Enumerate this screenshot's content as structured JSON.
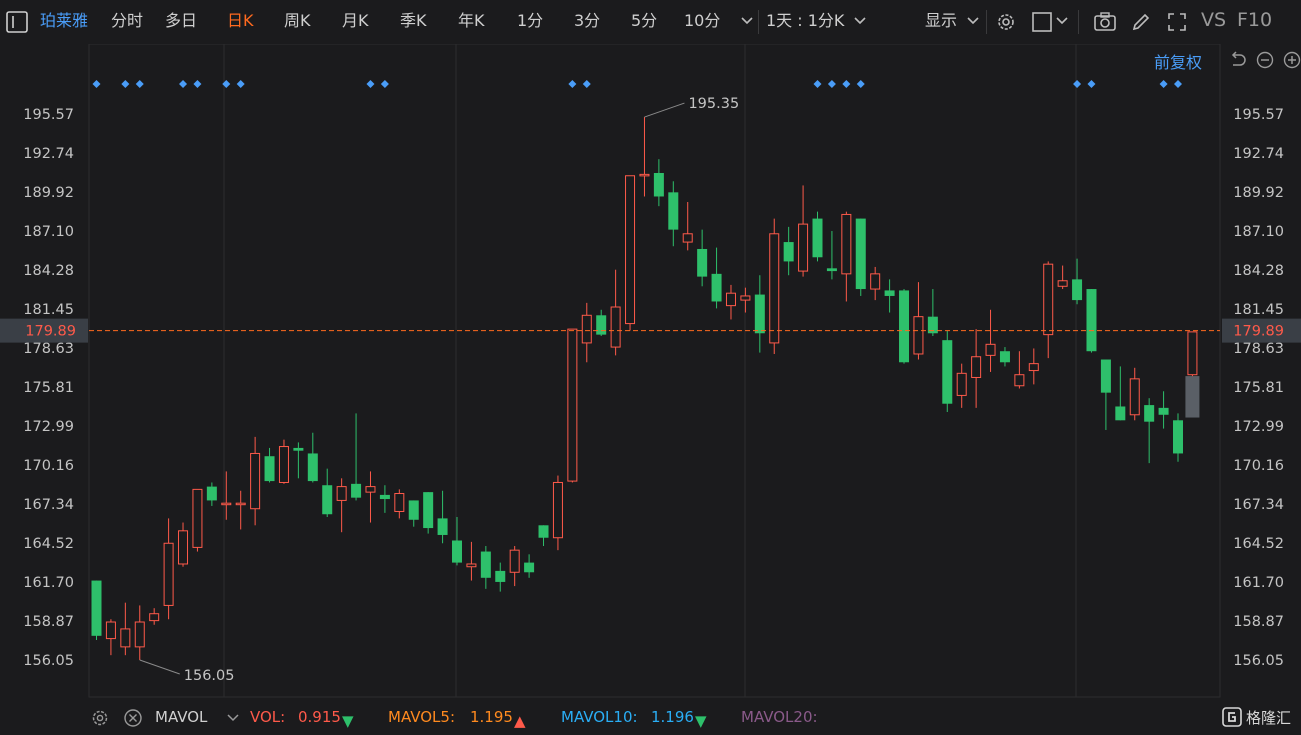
{
  "toolbar": {
    "stock_name": "珀莱雅",
    "periods": [
      "分时",
      "多日",
      "日K",
      "周K",
      "月K",
      "季K",
      "年K",
      "1分",
      "3分",
      "5分",
      "10分"
    ],
    "active_period": "日K",
    "interval_select": "1天 : 1分K",
    "display_label": "显示",
    "vs_label": "VS",
    "f10_label": "F10"
  },
  "colors": {
    "background": "#1b1b1d",
    "up": "#ff5a4a",
    "down": "#2ec06b",
    "active_tab": "#ff6a1f",
    "accent_blue": "#4a9df8",
    "current_price_line": "#ff6a1f",
    "grid": "#2c2c2e",
    "ghost_candle": "#5a5f66"
  },
  "icons": {
    "sidebar_toggle": "sidebar-toggle-icon",
    "dropdown": "chevron-down-icon",
    "settings": "gear-icon",
    "layout": "square-icon",
    "camera": "camera-icon",
    "draw": "pencil-icon",
    "fullscreen": "expand-icon",
    "reset_zoom": "undo-icon",
    "zoom_out": "zoom-out-icon",
    "zoom_in": "zoom-in-icon",
    "close": "close-circle-icon"
  },
  "adjust_label": "前复权",
  "current_price": "179.89",
  "chart_data": {
    "type": "candlestick",
    "y_ticks": [
      "195.57",
      "192.74",
      "189.92",
      "187.10",
      "184.28",
      "181.45",
      "178.63",
      "175.81",
      "172.99",
      "170.16",
      "167.34",
      "164.52",
      "161.70",
      "158.87",
      "156.05"
    ],
    "ylim": [
      156.05,
      195.57
    ],
    "current_price": 179.89,
    "max_annotation": {
      "value": 195.35,
      "label": "195.35",
      "index": 38
    },
    "min_annotation": {
      "value": 156.05,
      "label": "156.05",
      "index": 3
    },
    "candles": [
      {
        "o": 161.8,
        "h": 161.8,
        "l": 157.5,
        "c": 157.8
      },
      {
        "o": 157.6,
        "h": 159.0,
        "l": 156.4,
        "c": 158.8
      },
      {
        "o": 157.0,
        "h": 160.2,
        "l": 156.4,
        "c": 158.3
      },
      {
        "o": 157.0,
        "h": 160.0,
        "l": 156.05,
        "c": 158.8
      },
      {
        "o": 158.9,
        "h": 159.8,
        "l": 158.6,
        "c": 159.4
      },
      {
        "o": 160.0,
        "h": 166.3,
        "l": 159.0,
        "c": 164.5
      },
      {
        "o": 163.0,
        "h": 166.0,
        "l": 162.8,
        "c": 165.4
      },
      {
        "o": 164.2,
        "h": 168.4,
        "l": 163.9,
        "c": 168.4
      },
      {
        "o": 168.6,
        "h": 168.9,
        "l": 167.2,
        "c": 167.6
      },
      {
        "o": 167.4,
        "h": 169.7,
        "l": 166.2,
        "c": 167.4
      },
      {
        "o": 167.3,
        "h": 168.3,
        "l": 165.5,
        "c": 167.4
      },
      {
        "o": 167.0,
        "h": 172.2,
        "l": 165.8,
        "c": 171.0
      },
      {
        "o": 170.8,
        "h": 171.4,
        "l": 168.9,
        "c": 169.0
      },
      {
        "o": 168.9,
        "h": 172.0,
        "l": 168.8,
        "c": 171.5
      },
      {
        "o": 171.4,
        "h": 171.8,
        "l": 169.2,
        "c": 171.2
      },
      {
        "o": 171.0,
        "h": 172.5,
        "l": 168.9,
        "c": 169.0
      },
      {
        "o": 168.7,
        "h": 169.9,
        "l": 166.4,
        "c": 166.6
      },
      {
        "o": 167.6,
        "h": 169.2,
        "l": 165.3,
        "c": 168.6
      },
      {
        "o": 168.8,
        "h": 173.9,
        "l": 167.6,
        "c": 167.8
      },
      {
        "o": 168.2,
        "h": 169.7,
        "l": 166.0,
        "c": 168.6
      },
      {
        "o": 168.0,
        "h": 168.7,
        "l": 166.7,
        "c": 167.7
      },
      {
        "o": 166.8,
        "h": 168.4,
        "l": 166.3,
        "c": 168.1
      },
      {
        "o": 167.6,
        "h": 167.6,
        "l": 165.7,
        "c": 166.2
      },
      {
        "o": 168.2,
        "h": 168.2,
        "l": 165.2,
        "c": 165.6
      },
      {
        "o": 166.3,
        "h": 168.3,
        "l": 164.5,
        "c": 165.1
      },
      {
        "o": 164.7,
        "h": 166.4,
        "l": 162.9,
        "c": 163.1
      },
      {
        "o": 162.8,
        "h": 164.6,
        "l": 161.8,
        "c": 163.0
      },
      {
        "o": 163.9,
        "h": 164.3,
        "l": 161.2,
        "c": 162.0
      },
      {
        "o": 162.5,
        "h": 163.1,
        "l": 161.0,
        "c": 161.7
      },
      {
        "o": 162.4,
        "h": 164.3,
        "l": 161.4,
        "c": 164.0
      },
      {
        "o": 163.1,
        "h": 163.7,
        "l": 162.0,
        "c": 162.4
      },
      {
        "o": 165.8,
        "h": 165.8,
        "l": 164.3,
        "c": 164.9
      },
      {
        "o": 164.9,
        "h": 169.4,
        "l": 164.0,
        "c": 168.9
      },
      {
        "o": 169.0,
        "h": 180.0,
        "l": 168.9,
        "c": 180.0
      },
      {
        "o": 179.0,
        "h": 181.9,
        "l": 177.6,
        "c": 181.0
      },
      {
        "o": 181.0,
        "h": 181.4,
        "l": 179.5,
        "c": 179.6
      },
      {
        "o": 178.7,
        "h": 184.3,
        "l": 178.1,
        "c": 181.6
      },
      {
        "o": 180.4,
        "h": 189.8,
        "l": 179.9,
        "c": 191.1
      },
      {
        "o": 191.1,
        "h": 195.35,
        "l": 189.6,
        "c": 191.2
      },
      {
        "o": 191.3,
        "h": 192.3,
        "l": 188.9,
        "c": 189.6
      },
      {
        "o": 189.9,
        "h": 190.7,
        "l": 186.0,
        "c": 187.2
      },
      {
        "o": 186.3,
        "h": 189.2,
        "l": 185.7,
        "c": 186.9
      },
      {
        "o": 185.8,
        "h": 187.2,
        "l": 183.1,
        "c": 183.8
      },
      {
        "o": 184.0,
        "h": 185.9,
        "l": 181.5,
        "c": 182.0
      },
      {
        "o": 181.7,
        "h": 183.2,
        "l": 180.7,
        "c": 182.6
      },
      {
        "o": 182.1,
        "h": 183.0,
        "l": 181.2,
        "c": 182.4
      },
      {
        "o": 182.5,
        "h": 183.9,
        "l": 178.3,
        "c": 179.7
      },
      {
        "o": 179.0,
        "h": 188.0,
        "l": 178.2,
        "c": 186.9
      },
      {
        "o": 186.3,
        "h": 187.4,
        "l": 183.9,
        "c": 184.9
      },
      {
        "o": 184.2,
        "h": 190.4,
        "l": 183.8,
        "c": 187.6
      },
      {
        "o": 188.0,
        "h": 188.5,
        "l": 184.9,
        "c": 185.2
      },
      {
        "o": 184.4,
        "h": 187.1,
        "l": 183.6,
        "c": 184.2
      },
      {
        "o": 184.0,
        "h": 188.5,
        "l": 182.0,
        "c": 188.3
      },
      {
        "o": 188.0,
        "h": 188.0,
        "l": 182.4,
        "c": 182.9
      },
      {
        "o": 182.9,
        "h": 184.5,
        "l": 182.1,
        "c": 184.0
      },
      {
        "o": 182.8,
        "h": 183.6,
        "l": 181.2,
        "c": 182.4
      },
      {
        "o": 182.8,
        "h": 182.9,
        "l": 177.5,
        "c": 177.6
      },
      {
        "o": 178.2,
        "h": 183.4,
        "l": 177.8,
        "c": 180.9
      },
      {
        "o": 180.9,
        "h": 182.9,
        "l": 179.5,
        "c": 179.7
      },
      {
        "o": 179.2,
        "h": 179.9,
        "l": 174.0,
        "c": 174.6
      },
      {
        "o": 175.2,
        "h": 177.5,
        "l": 174.3,
        "c": 176.8
      },
      {
        "o": 176.5,
        "h": 180.0,
        "l": 174.3,
        "c": 178.0
      },
      {
        "o": 178.1,
        "h": 181.4,
        "l": 176.9,
        "c": 178.9
      },
      {
        "o": 178.4,
        "h": 178.7,
        "l": 177.3,
        "c": 177.6
      },
      {
        "o": 175.9,
        "h": 178.4,
        "l": 175.7,
        "c": 176.7
      },
      {
        "o": 177.0,
        "h": 178.6,
        "l": 176.0,
        "c": 177.5
      },
      {
        "o": 179.6,
        "h": 184.9,
        "l": 177.9,
        "c": 184.7
      },
      {
        "o": 183.1,
        "h": 184.6,
        "l": 182.9,
        "c": 183.5
      },
      {
        "o": 183.6,
        "h": 185.1,
        "l": 181.8,
        "c": 182.1
      },
      {
        "o": 182.9,
        "h": 182.9,
        "l": 178.3,
        "c": 178.4
      },
      {
        "o": 177.8,
        "h": 177.8,
        "l": 172.7,
        "c": 175.4
      },
      {
        "o": 174.4,
        "h": 177.3,
        "l": 173.4,
        "c": 173.4
      },
      {
        "o": 173.8,
        "h": 177.2,
        "l": 173.4,
        "c": 176.4
      },
      {
        "o": 174.5,
        "h": 175.0,
        "l": 170.3,
        "c": 173.3
      },
      {
        "o": 174.3,
        "h": 175.5,
        "l": 172.8,
        "c": 173.8
      },
      {
        "o": 173.4,
        "h": 173.9,
        "l": 170.4,
        "c": 171.0
      },
      {
        "o": 176.7,
        "h": 179.8,
        "l": 176.1,
        "c": 179.8
      }
    ],
    "ghost_candle": {
      "index": 76,
      "top": 176.6,
      "bottom": 173.6
    },
    "marker_columns": [
      0,
      2,
      3,
      6,
      7,
      9,
      10,
      19,
      20,
      33,
      34,
      50,
      51,
      52,
      53,
      68,
      69,
      74,
      75
    ],
    "indicator": {
      "name": "MAVOL",
      "vol_label": "VOL:",
      "vol_value": "0.915",
      "vol_dir": "down",
      "ma5_label": "MAVOL5:",
      "ma5_value": "1.195",
      "ma5_dir": "up",
      "ma10_label": "MAVOL10:",
      "ma10_value": "1.196",
      "ma10_dir": "down",
      "ma20_label": "MAVOL20:"
    }
  },
  "logo_text": "格隆汇"
}
